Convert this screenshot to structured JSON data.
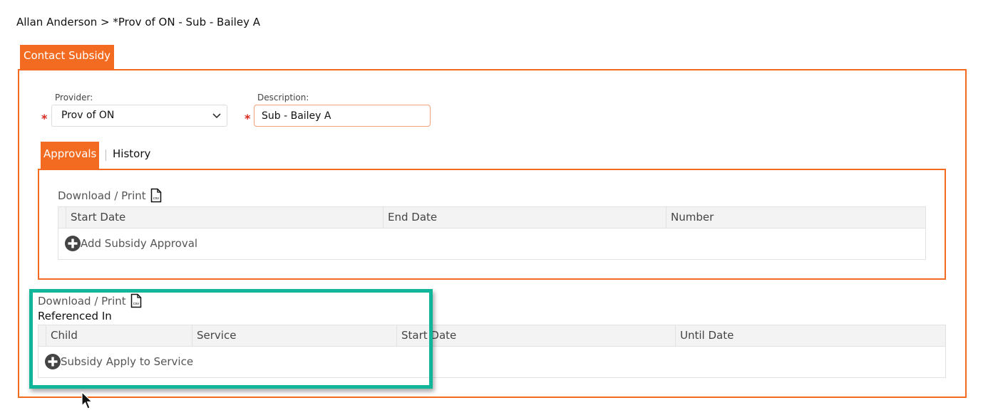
{
  "breadcrumb": {
    "person": "Allan Anderson",
    "separator": ">",
    "record": "*Prov of ON - Sub - Bailey A"
  },
  "main_tab": {
    "label": "Contact Subsidy"
  },
  "form": {
    "provider_label": "Provider:",
    "provider_value": "Prov of ON",
    "description_label": "Description:",
    "description_value": "Sub - Bailey A",
    "required_mark": "*"
  },
  "sub_tabs": [
    {
      "label": "Approvals",
      "active": true
    },
    {
      "label": "History",
      "active": false
    }
  ],
  "approvals": {
    "download_label": "Download / Print",
    "columns": [
      "Start Date",
      "End Date",
      "Number"
    ],
    "add_label": "Add Subsidy Approval"
  },
  "references": {
    "download_label": "Download / Print",
    "title": "Referenced In",
    "columns": [
      "Child",
      "Service",
      "Start Date",
      "Until Date"
    ],
    "add_label": "Subsidy Apply to Service"
  },
  "icons": {
    "file": "csv-file-icon",
    "add": "plus-circle-icon",
    "dropdown": "chevron-down-icon",
    "pointer": "mouse-cursor-icon"
  },
  "colors": {
    "accent": "#f36b21",
    "highlight": "#10b59a",
    "required": "#d9261c"
  }
}
